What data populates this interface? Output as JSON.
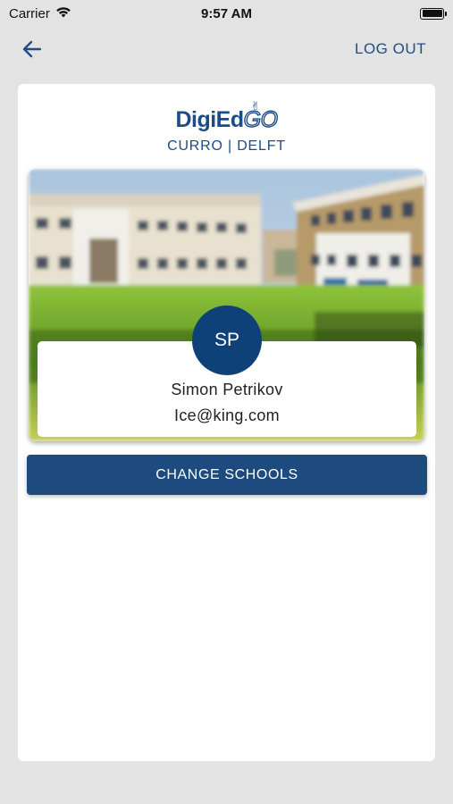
{
  "status_bar": {
    "carrier": "Carrier",
    "time": "9:57 AM",
    "battery_level": 1.0
  },
  "nav": {
    "back_icon": "arrow-left-icon",
    "logout_label": "LOG OUT",
    "accent_color": "#1f4e85"
  },
  "branding": {
    "logo_text": "DigiEd",
    "logo_suffix": "GO",
    "school_name": "CURRO | DELFT"
  },
  "profile": {
    "initials": "SP",
    "name": "Simon Petrikov",
    "email": "Ice@king.com",
    "avatar_color": "#0f4179"
  },
  "actions": {
    "change_schools_label": "CHANGE SCHOOLS",
    "button_color": "#1d4b80"
  }
}
